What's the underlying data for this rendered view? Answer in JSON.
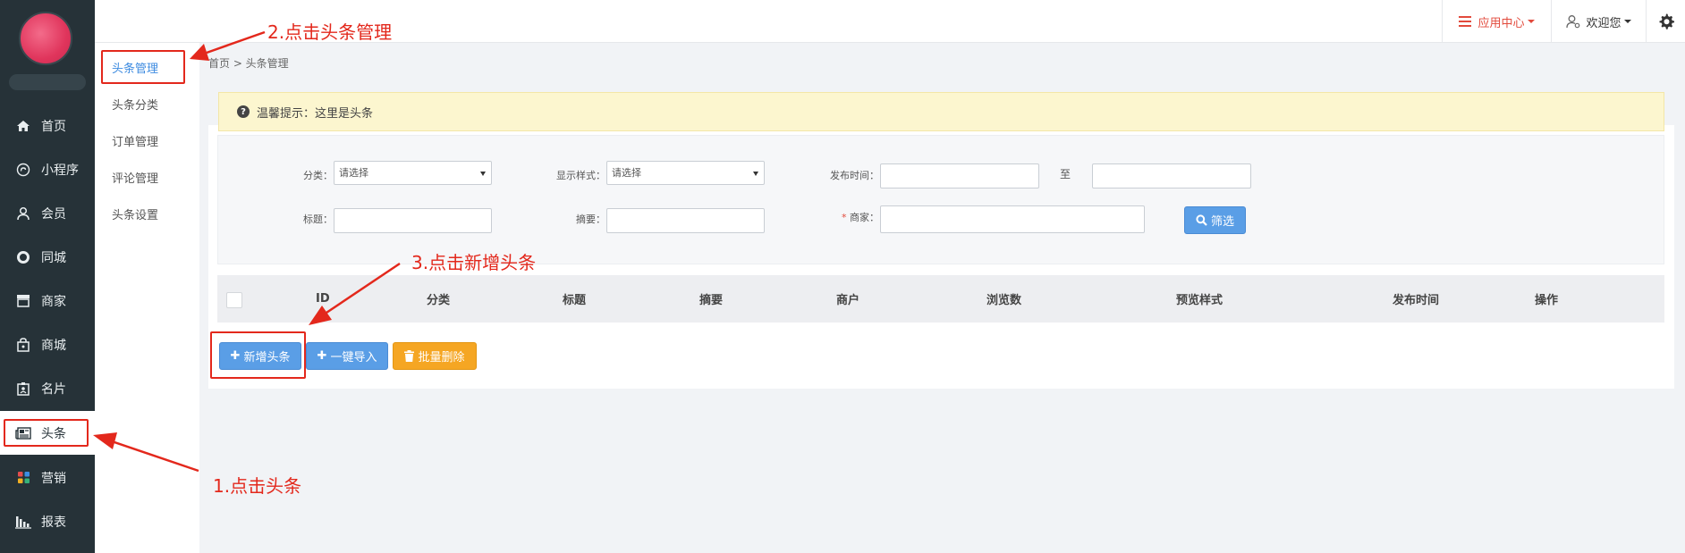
{
  "sidebar": {
    "items": [
      {
        "label": "首页",
        "icon": "home-icon"
      },
      {
        "label": "小程序",
        "icon": "miniprogram-icon"
      },
      {
        "label": "会员",
        "icon": "user-icon"
      },
      {
        "label": "同城",
        "icon": "circle-icon"
      },
      {
        "label": "商家",
        "icon": "store-icon"
      },
      {
        "label": "商城",
        "icon": "bag-icon"
      },
      {
        "label": "名片",
        "icon": "card-icon"
      },
      {
        "label": "头条",
        "icon": "newspaper-icon",
        "active": true
      },
      {
        "label": "营销",
        "icon": "grid-icon"
      },
      {
        "label": "报表",
        "icon": "bar-chart-icon"
      }
    ]
  },
  "subnav": {
    "items": [
      {
        "label": "头条管理",
        "active": true
      },
      {
        "label": "头条分类"
      },
      {
        "label": "订单管理"
      },
      {
        "label": "评论管理"
      },
      {
        "label": "头条设置"
      }
    ]
  },
  "topbar": {
    "app_center": "应用中心",
    "welcome": "欢迎您"
  },
  "breadcrumb": "首页 > 头条管理",
  "tip": "温馨提示：这里是头条",
  "filter": {
    "category_label": "分类：",
    "category_value": "请选择",
    "display_style_label": "显示样式：",
    "display_style_value": "请选择",
    "publish_time_label": "发布时间：",
    "to_label": "至",
    "title_label": "标题：",
    "summary_label": "摘要：",
    "merchant_required": "*",
    "merchant_label": " 商家：",
    "filter_button": "筛选"
  },
  "table": {
    "columns": [
      "ID",
      "分类",
      "标题",
      "摘要",
      "商户",
      "浏览数",
      "预览样式",
      "发布时间",
      "操作"
    ]
  },
  "actions": {
    "add": "新增头条",
    "import": "一键导入",
    "batch_delete": "批量删除"
  },
  "annotations": {
    "step1": "1.点击头条",
    "step2": "2.点击头条管理",
    "step3": "3.点击新增头条"
  },
  "colors": {
    "sidebar_bg": "#263238",
    "primary": "#5a9ee6",
    "warning": "#f5a623",
    "annotation": "#e3281c",
    "app_center": "#e24a3c"
  }
}
